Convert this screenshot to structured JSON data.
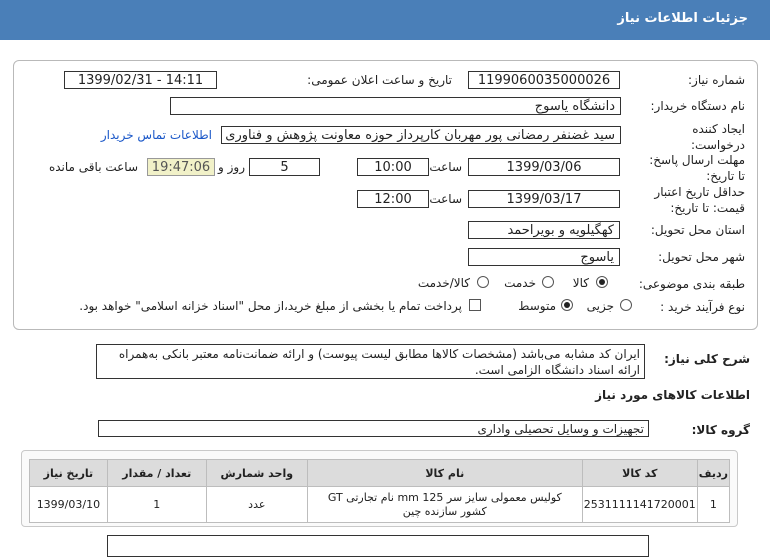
{
  "header": {
    "title": "جزئیات اطلاعات نیاز"
  },
  "form": {
    "need_number_label": "شماره نیاز:",
    "need_number": "1199060035000026",
    "announce_label": "تاریخ و ساعت اعلان عمومی:",
    "announce_value": "1399/02/31 - 14:11",
    "buyer_org_label": "نام دستگاه خریدار:",
    "buyer_org": "دانشگاه یاسوج",
    "creator_label": "ایجاد کننده درخواست:",
    "creator": "سید غضنفر رمضانی پور مهربان کارپرداز حوزه معاونت پژوهش و فناوری دانشگاه یاسوج",
    "contact_link": "اطلاعات تماس خریدار",
    "reply_deadline_label": "مهلت ارسال پاسخ: تا تاریخ:",
    "reply_date": "1399/03/06",
    "time_label": "ساعت",
    "reply_time": "10:00",
    "days_value": "5",
    "days_label": "روز و",
    "remaining_time": "19:47:06",
    "remaining_label": "ساعت باقی مانده",
    "price_validity_label": "حداقل تاریخ اعتبار قیمت: تا تاریخ:",
    "price_date": "1399/03/17",
    "price_time": "12:00",
    "province_label": "استان محل تحویل:",
    "province": "کهگیلویه و بویراحمد",
    "city_label": "شهر محل تحویل:",
    "city": "یاسوج",
    "category_label": "طبقه بندی موضوعی:",
    "category_options": [
      "کالا",
      "خدمت",
      "کالا/خدمت"
    ],
    "category_selected": "کالا",
    "process_label": "نوع فرآیند خرید :",
    "process_options": [
      "جزیی",
      "متوسط"
    ],
    "process_selected": "متوسط",
    "payment_note": "پرداخت تمام یا بخشی از مبلغ خرید،از محل \"اسناد خزانه اسلامی\" خواهد بود."
  },
  "description": {
    "label": "شرح کلی نیاز:",
    "text": "ایران کد مشابه می‌باشد (مشخصات کالاها مطابق لیست پیوست) و ارائه ضمانت‌نامه معتبر بانکی به‌همراه ارائه اسناد دانشگاه الزامی است."
  },
  "goods_section": {
    "title": "اطلاعات کالاهای مورد نیاز"
  },
  "goods_group": {
    "label": "گروه کالا:",
    "value": "تجهیزات و وسایل تحصیلی واداری"
  },
  "table": {
    "headers": [
      "ردیف",
      "کد کالا",
      "نام کالا",
      "واحد شمارش",
      "تعداد / مقدار",
      "تاریخ نیاز"
    ],
    "rows": [
      [
        "1",
        "2531111141720001",
        "کولیس معمولی سایز سر 125 mm نام تجارتی GT کشور سازنده چین",
        "عدد",
        "1",
        "1399/03/10"
      ]
    ]
  }
}
